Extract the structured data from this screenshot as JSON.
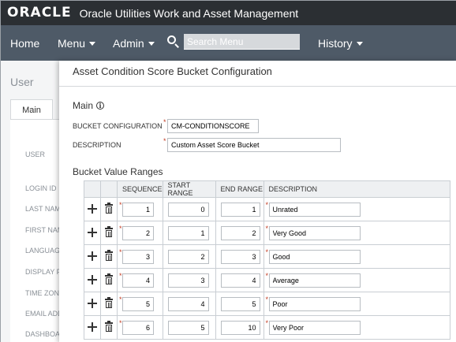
{
  "header": {
    "brand": "ORACLE",
    "app_title": "Oracle Utilities Work and Asset Management"
  },
  "nav": {
    "home": "Home",
    "menu": "Menu",
    "admin": "Admin",
    "search_placeholder": "Search Menu",
    "history": "History"
  },
  "background": {
    "title": "User",
    "tab": "Main",
    "labels": [
      "USER",
      "LOGIN ID",
      "LAST NAME",
      "FIRST NAME",
      "LANGUAGE",
      "DISPLAY PROFILE",
      "TIME ZONE",
      "EMAIL ADDRESS",
      "DASHBOARD"
    ]
  },
  "modal": {
    "title": "Asset Condition Score Bucket Configuration",
    "section_main": "Main",
    "bucket_config_label": "BUCKET CONFIGURATION",
    "bucket_config_value": "CM-CONDITIONSCORE",
    "description_label": "DESCRIPTION",
    "description_value": "Custom Asset Score Bucket",
    "section_ranges": "Bucket Value Ranges",
    "columns": [
      "SEQUENCE",
      "START RANGE",
      "END RANGE",
      "DESCRIPTION"
    ],
    "rows": [
      {
        "sequence": "1",
        "start": "0",
        "end": "1",
        "description": "Unrated"
      },
      {
        "sequence": "2",
        "start": "1",
        "end": "2",
        "description": "Very Good"
      },
      {
        "sequence": "3",
        "start": "2",
        "end": "3",
        "description": "Good"
      },
      {
        "sequence": "4",
        "start": "3",
        "end": "4",
        "description": "Average"
      },
      {
        "sequence": "5",
        "start": "4",
        "end": "5",
        "description": "Poor"
      },
      {
        "sequence": "6",
        "start": "5",
        "end": "10",
        "description": "Very Poor"
      }
    ]
  },
  "colors": {
    "titlebar": "#2b2f33",
    "navbar": "#4e5a67",
    "required": "#c23b22"
  },
  "icons": [
    "search-icon",
    "caret-down-icon",
    "info-icon",
    "plus-icon",
    "trash-icon"
  ]
}
